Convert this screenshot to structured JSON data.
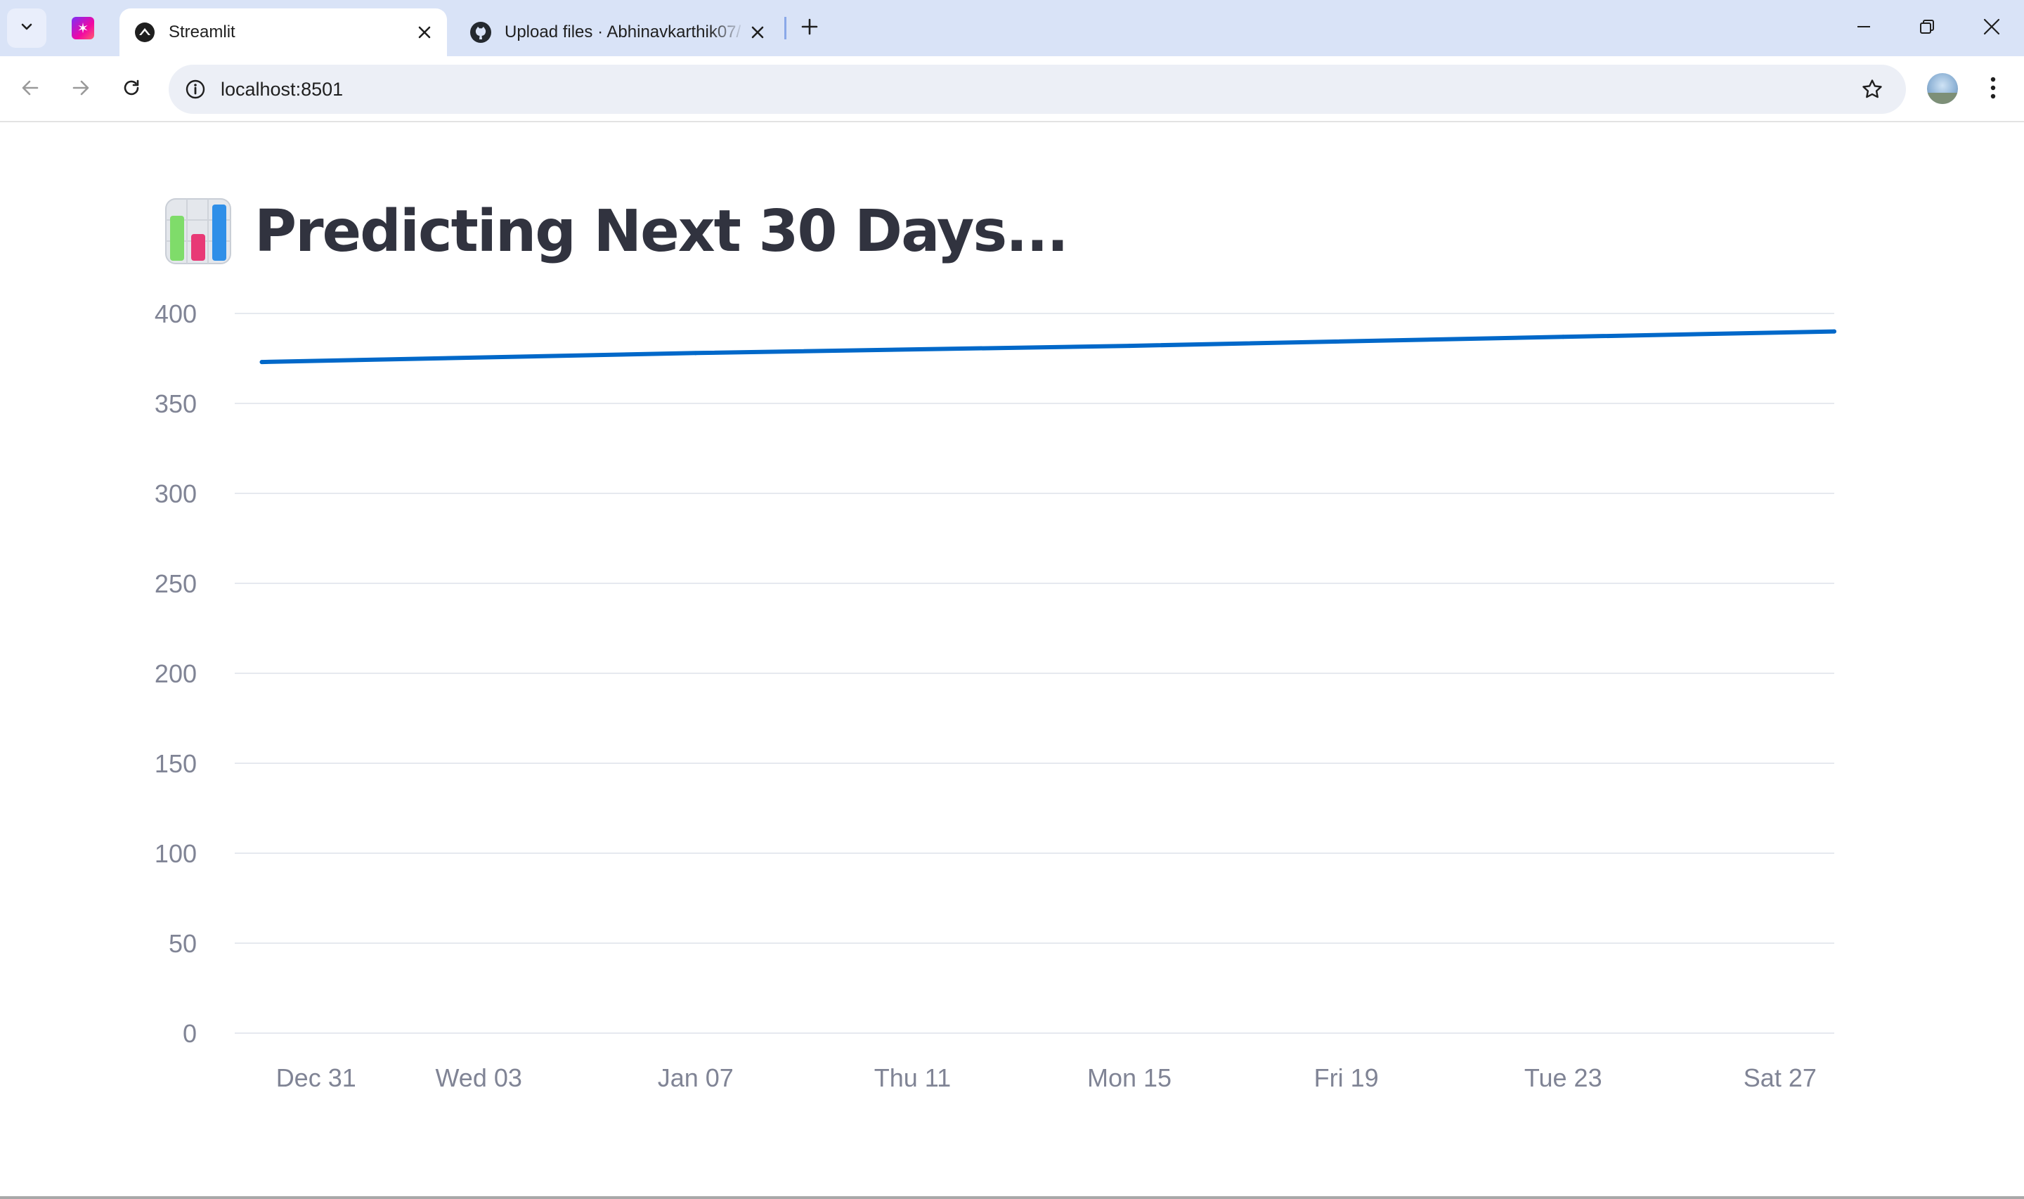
{
  "browser": {
    "tabs": [
      {
        "title": "Streamlit",
        "active": true,
        "icon": "streamlit-icon"
      },
      {
        "title": "Upload files · Abhinavkarthik07/",
        "active": false,
        "icon": "github-icon"
      }
    ],
    "url": "localhost:8501",
    "accent": "#d9e3f7"
  },
  "page": {
    "title": "Predicting Next 30 Days...",
    "title_icon": "bar-chart-emoji"
  },
  "chart_data": {
    "type": "line",
    "title": "",
    "xlabel": "",
    "ylabel": "",
    "grid": true,
    "line_color": "#0068c9",
    "ylim": [
      0,
      400
    ],
    "y_ticks": [
      "0",
      "50",
      "100",
      "150",
      "200",
      "250",
      "300",
      "350",
      "400"
    ],
    "x_ticks": [
      {
        "label": "Dec 31",
        "date": "2023-12-31"
      },
      {
        "label": "Wed 03",
        "date": "2024-01-03"
      },
      {
        "label": "Jan 07",
        "date": "2024-01-07"
      },
      {
        "label": "Thu 11",
        "date": "2024-01-11"
      },
      {
        "label": "Mon 15",
        "date": "2024-01-15"
      },
      {
        "label": "Fri 19",
        "date": "2024-01-19"
      },
      {
        "label": "Tue 23",
        "date": "2024-01-23"
      },
      {
        "label": "Sat 27",
        "date": "2024-01-27"
      }
    ],
    "series": [
      {
        "x": [
          "2023-12-30",
          "2024-01-07",
          "2024-01-15",
          "2024-01-23",
          "2024-01-28"
        ],
        "values": [
          373,
          378,
          382,
          387,
          390
        ]
      }
    ]
  }
}
